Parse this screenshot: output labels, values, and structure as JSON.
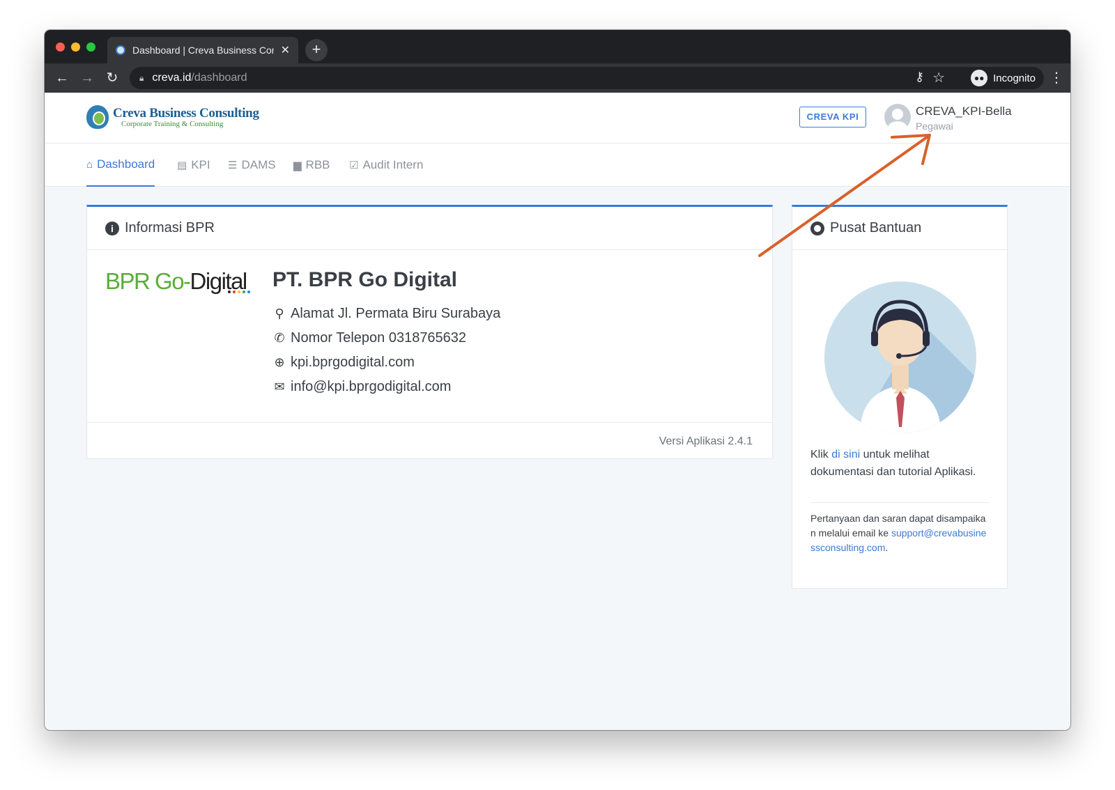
{
  "browser": {
    "tab_title": "Dashboard | Creva Business Consulting",
    "tab_close": "✕",
    "new_tab": "+",
    "url_host": "creva.id",
    "url_path": "/dashboard",
    "incognito_label": "Incognito"
  },
  "header": {
    "brand": "Creva Business Consulting",
    "tagline": "Corporate Training & Consulting",
    "app_button": "CREVA KPI",
    "user_name": "CREVA_KPI-Bella",
    "user_role": "Pegawai"
  },
  "nav": {
    "items": [
      {
        "label": "Dashboard",
        "icon": "home-icon",
        "active": true
      },
      {
        "label": "KPI",
        "icon": "clipboard-icon",
        "active": false
      },
      {
        "label": "DAMS",
        "icon": "list-icon",
        "active": false
      },
      {
        "label": "RBB",
        "icon": "book-icon",
        "active": false
      },
      {
        "label": "Audit Intern",
        "icon": "clipboard-check-icon",
        "active": false
      }
    ]
  },
  "info_card": {
    "title": "Informasi BPR",
    "logo_part1": "BPR Go-",
    "logo_part2": "Digital",
    "company_name": "PT. BPR Go Digital",
    "address": "Alamat Jl. Permata Biru Surabaya",
    "phone": "Nomor Telepon 0318765632",
    "website": "kpi.bprgodigital.com",
    "email": "info@kpi.bprgodigital.com",
    "version": "Versi Aplikasi 2.4.1"
  },
  "help_card": {
    "title": "Pusat Bantuan",
    "text_before": "Klik ",
    "link_text": "di sini",
    "text_after": " untuk melihat dokumentasi dan tutorial Aplikasi.",
    "small_text": "Pertanyaan dan saran dapat disampaikan melalui email ke ",
    "support_email": "support@crevabusinessconsulting.com",
    "small_end": "."
  },
  "colors": {
    "accent": "#3a7bd5",
    "annotation_arrow": "#d9612a",
    "logo_green": "#5aae3a"
  }
}
